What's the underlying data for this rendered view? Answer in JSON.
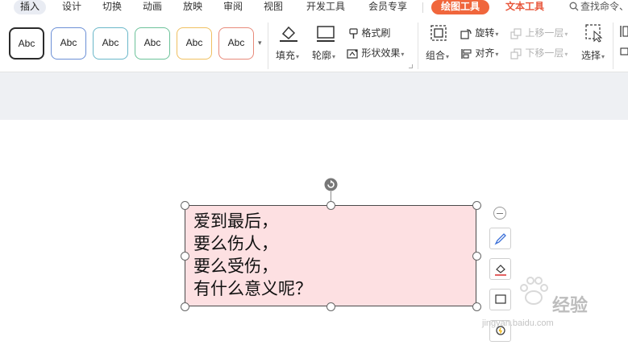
{
  "menubar": {
    "tabs": [
      "插入",
      "设计",
      "切换",
      "动画",
      "放映",
      "审阅",
      "视图",
      "开发工具",
      "会员专享"
    ],
    "active_tab": "插入",
    "context_tabs": {
      "draw_tools": "绘图工具",
      "text_tools": "文本工具"
    },
    "search_label": "查找命令、"
  },
  "ribbon": {
    "shape_styles": [
      {
        "label": "Abc",
        "border": "#2b2b2b"
      },
      {
        "label": "Abc",
        "border": "#6b8fd6"
      },
      {
        "label": "Abc",
        "border": "#6ab7c9"
      },
      {
        "label": "Abc",
        "border": "#6cc29a"
      },
      {
        "label": "Abc",
        "border": "#f0c060"
      },
      {
        "label": "Abc",
        "border": "#e88a7a"
      }
    ],
    "fill_label": "填充",
    "outline_label": "轮廓",
    "format_painter_label": "格式刷",
    "shape_effects_label": "形状效果",
    "group_label": "组合",
    "rotate_label": "旋转",
    "align_label": "对齐",
    "bring_forward_label": "上移一层",
    "send_backward_label": "下移一层",
    "select_label": "选择"
  },
  "slide": {
    "textbox_lines": [
      "爱到最后，",
      "要么伤人，",
      "要么受伤，",
      "有什么意义呢？"
    ],
    "fill_color": "#fde0e2"
  },
  "watermark": {
    "text": "经验",
    "url": "jingyan.baidu.com"
  }
}
